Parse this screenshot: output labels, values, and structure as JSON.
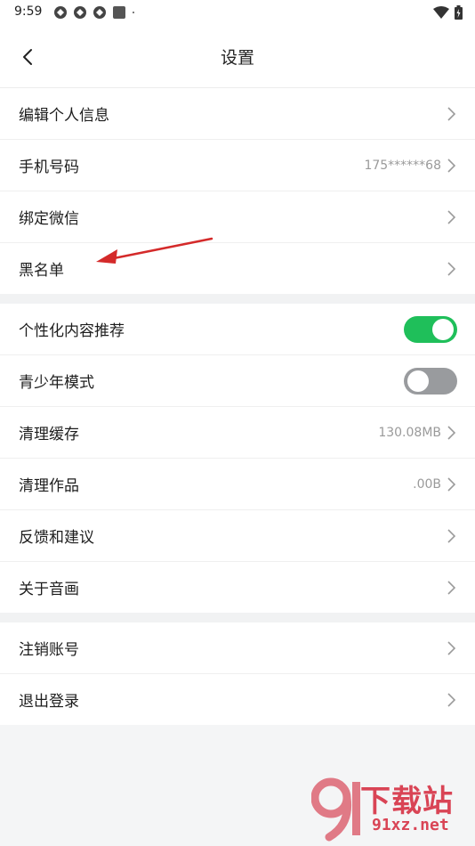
{
  "status_bar": {
    "time": "9:59"
  },
  "header": {
    "title": "设置"
  },
  "groups": [
    {
      "items": [
        {
          "label": "编辑个人信息",
          "value": ""
        },
        {
          "label": "手机号码",
          "value": "175******68"
        },
        {
          "label": "绑定微信",
          "value": ""
        },
        {
          "label": "黑名单",
          "value": ""
        }
      ]
    },
    {
      "items": [
        {
          "label": "个性化内容推荐",
          "toggle": "on"
        },
        {
          "label": "青少年模式",
          "toggle": "off"
        },
        {
          "label": "清理缓存",
          "value": "130.08MB"
        },
        {
          "label": "清理作品",
          "value": ".00B"
        },
        {
          "label": "反馈和建议",
          "value": ""
        },
        {
          "label": "关于音画",
          "value": ""
        }
      ]
    },
    {
      "items": [
        {
          "label": "注销账号",
          "value": ""
        },
        {
          "label": "退出登录",
          "value": ""
        }
      ]
    }
  ],
  "watermark": {
    "brand": "下载站",
    "url": "91xz.net",
    "logo": "91"
  },
  "colors": {
    "toggle_on": "#1fbf5a",
    "toggle_off": "#999b9e",
    "arrow": "#d42a2a"
  }
}
